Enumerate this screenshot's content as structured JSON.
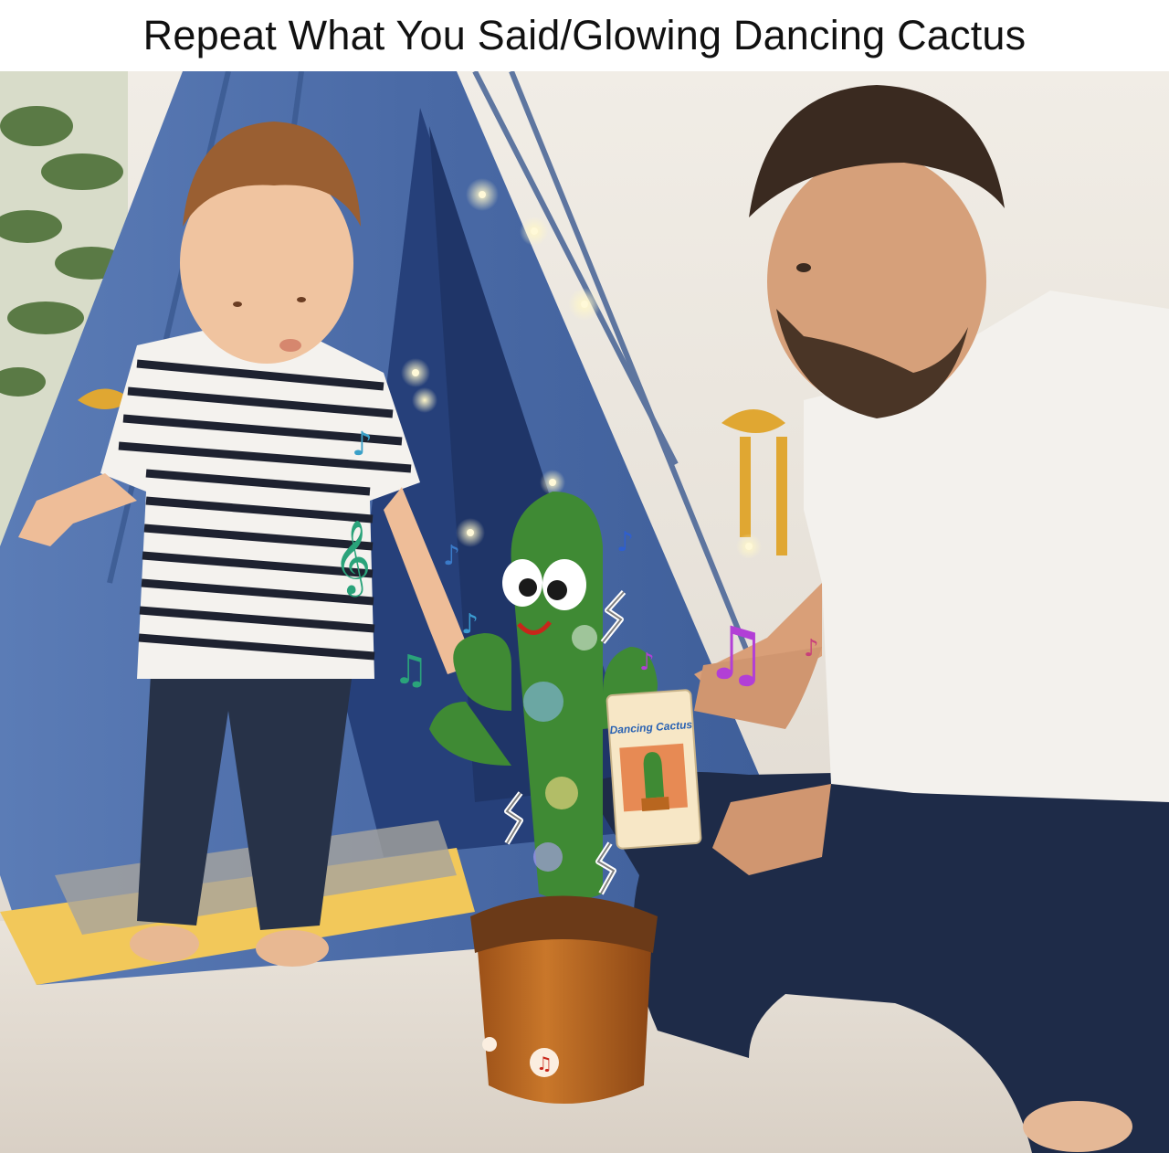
{
  "header": {
    "title": "Repeat What You Said/Glowing Dancing Cactus"
  },
  "product_tag": {
    "label": "Dancing Cactus"
  },
  "colors": {
    "tent": "#4e6fa8",
    "tent_dark": "#2f4d8a",
    "cactus": "#3f8a34",
    "pot": "#b8661f",
    "floor": "#e8e0d6",
    "music_note_purple": "#b23fd6",
    "music_note_teal": "#2aa37a"
  },
  "icons": [
    "music-note-icon",
    "treble-clef-icon",
    "sound-wave-icon",
    "play-button-icon"
  ]
}
